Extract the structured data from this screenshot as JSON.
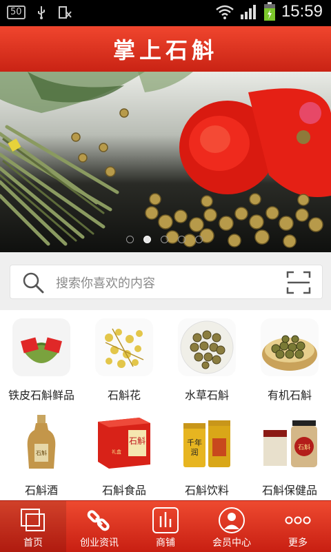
{
  "status_bar": {
    "badge": "50",
    "time": "15:59"
  },
  "header": {
    "title": "掌上石斛"
  },
  "banner": {
    "slide_count": 5,
    "active_slide": 2
  },
  "search": {
    "placeholder": "搜索你喜欢的内容"
  },
  "categories": [
    {
      "label": "铁皮石斛鲜品"
    },
    {
      "label": "石斛花"
    },
    {
      "label": "水草石斛"
    },
    {
      "label": "有机石斛"
    },
    {
      "label": "石斛酒"
    },
    {
      "label": "石斛食品"
    },
    {
      "label": "石斛饮料"
    },
    {
      "label": "石斛保健品"
    }
  ],
  "tabs": [
    {
      "label": "首页",
      "active": true
    },
    {
      "label": "创业资讯",
      "active": false
    },
    {
      "label": "商铺",
      "active": false
    },
    {
      "label": "会员中心",
      "active": false
    },
    {
      "label": "更多",
      "active": false
    }
  ]
}
